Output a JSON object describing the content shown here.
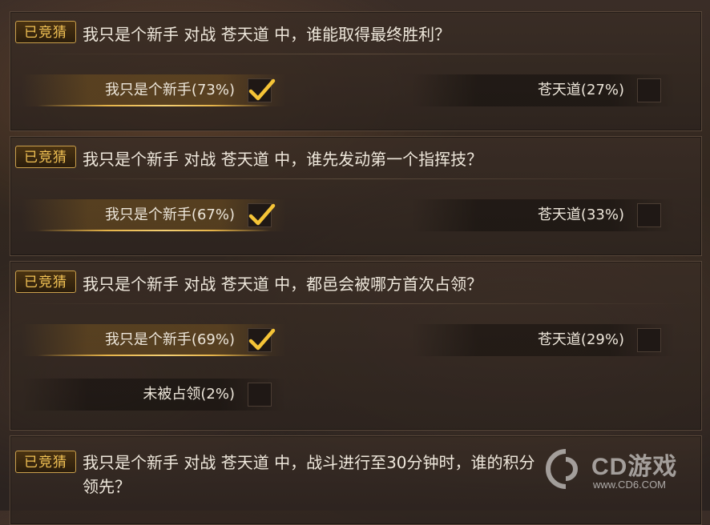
{
  "questions": [
    {
      "badge": "已竞猜",
      "text": "我只是个新手 对战 苍天道 中，谁能取得最终胜利？",
      "options": [
        {
          "label": "我只是个新手(73%)",
          "checked": true
        },
        {
          "label": "苍天道(27%)",
          "checked": false
        }
      ]
    },
    {
      "badge": "已竞猜",
      "text": "我只是个新手 对战 苍天道 中，谁先发动第一个指挥技？",
      "options": [
        {
          "label": "我只是个新手(67%)",
          "checked": true
        },
        {
          "label": "苍天道(33%)",
          "checked": false
        }
      ]
    },
    {
      "badge": "已竞猜",
      "text": "我只是个新手 对战 苍天道 中，都邑会被哪方首次占领？",
      "options": [
        {
          "label": "我只是个新手(69%)",
          "checked": true
        },
        {
          "label": "苍天道(29%)",
          "checked": false
        },
        {
          "label": "未被占领(2%)",
          "checked": false
        }
      ]
    },
    {
      "badge": "已竞猜",
      "text_line1": "我只是个新手 对战 苍天道 中，战斗进行至30分钟时，谁的积分",
      "text_line2": "领先？"
    }
  ],
  "watermark": {
    "brand": "CD游戏",
    "url": "www.CD6.COM"
  },
  "colors": {
    "accent_gold": "#f2c254",
    "check_gold": "#f5c437",
    "text": "#efe8dc"
  }
}
